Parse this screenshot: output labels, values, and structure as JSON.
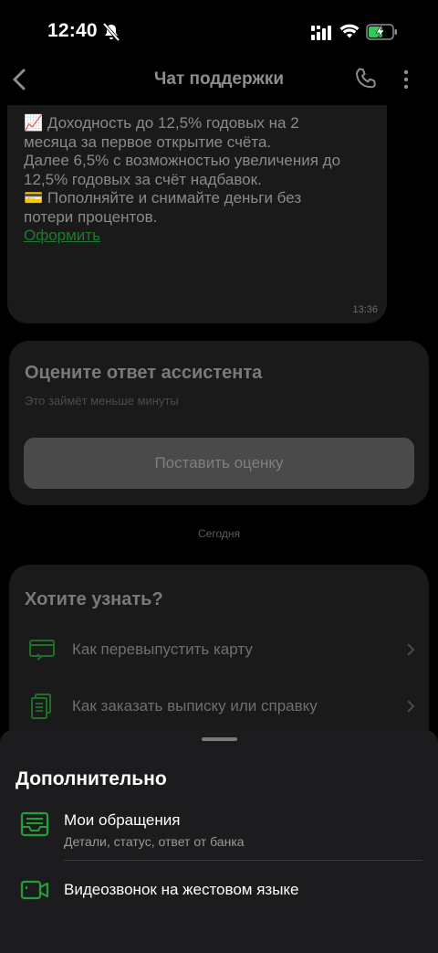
{
  "status_bar": {
    "time": "12:40"
  },
  "header": {
    "title": "Чат поддержки"
  },
  "chat": {
    "bubble": {
      "text": "📈 Доходность до 12,5% годовых на 2\nмесяца за первое открытие счёта.\nДалее 6,5% с возможностью увеличения до\n12,5% годовых за счёт надбавок.\n💳 Пополняйте и снимайте деньги без\nпотери процентов.",
      "link": "Оформить",
      "time": "13:36"
    },
    "rating": {
      "title": "Оцените ответ ассистента",
      "subtitle": "Это займёт меньше минуты",
      "button": "Поставить оценку"
    },
    "date_divider": "Сегодня",
    "faq": {
      "title": "Хотите узнать?",
      "items": [
        {
          "label": "Как перевыпустить карту",
          "icon": "card-reissue-icon"
        },
        {
          "label": "Как заказать выписку или справку",
          "icon": "documents-icon"
        }
      ]
    }
  },
  "sheet": {
    "title": "Дополнительно",
    "items": [
      {
        "label": "Мои обращения",
        "sub": "Детали, статус, ответ от банка",
        "icon": "inbox-icon"
      },
      {
        "label": "Видеозвонок на жестовом языке",
        "icon": "video-camera-icon"
      }
    ]
  },
  "colors": {
    "accent_green": "#21a038",
    "dim_green": "#1e7a2e",
    "background": "#000000",
    "sheet_background": "#1c1c1e"
  }
}
